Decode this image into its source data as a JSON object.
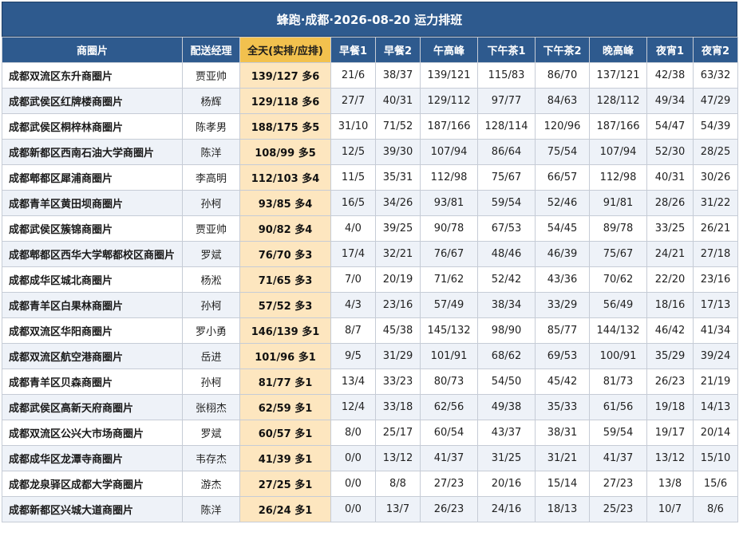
{
  "title": "蜂跑·成都·2026-08-20 运力排班",
  "headers": [
    "商圈片",
    "配送经理",
    "全天(实排/应排)",
    "早餐1",
    "早餐2",
    "午高峰",
    "下午茶1",
    "下午茶2",
    "晚高峰",
    "夜宵1",
    "夜宵2"
  ],
  "rows": [
    {
      "area": "成都双流区东升商圈片",
      "manager": "贾亚帅",
      "total": "139/127 多6",
      "slots": [
        "21/6",
        "38/37",
        "139/121",
        "115/83",
        "86/70",
        "137/121",
        "42/38",
        "63/32"
      ]
    },
    {
      "area": "成都武侯区红牌楼商圈片",
      "manager": "杨辉",
      "total": "129/118 多6",
      "slots": [
        "27/7",
        "40/31",
        "129/112",
        "97/77",
        "84/63",
        "128/112",
        "49/34",
        "47/29"
      ]
    },
    {
      "area": "成都武侯区桐梓林商圈片",
      "manager": "陈孝男",
      "total": "188/175 多5",
      "slots": [
        "31/10",
        "71/52",
        "187/166",
        "128/114",
        "120/96",
        "187/166",
        "54/47",
        "54/39"
      ]
    },
    {
      "area": "成都新都区西南石油大学商圈片",
      "manager": "陈洋",
      "total": "108/99 多5",
      "slots": [
        "12/5",
        "39/30",
        "107/94",
        "86/64",
        "75/54",
        "107/94",
        "52/30",
        "28/25"
      ]
    },
    {
      "area": "成都郫都区犀浦商圈片",
      "manager": "李高明",
      "total": "112/103 多4",
      "slots": [
        "11/5",
        "35/31",
        "112/98",
        "75/67",
        "66/57",
        "112/98",
        "40/31",
        "30/26"
      ]
    },
    {
      "area": "成都青羊区黄田坝商圈片",
      "manager": "孙柯",
      "total": "93/85 多4",
      "slots": [
        "16/5",
        "34/26",
        "93/81",
        "59/54",
        "52/46",
        "91/81",
        "28/26",
        "31/22"
      ]
    },
    {
      "area": "成都武侯区簇锦商圈片",
      "manager": "贾亚帅",
      "total": "90/82 多4",
      "slots": [
        "4/0",
        "39/25",
        "90/78",
        "67/53",
        "54/45",
        "89/78",
        "33/25",
        "26/21"
      ]
    },
    {
      "area": "成都郫都区西华大学郫都校区商圈片",
      "manager": "罗斌",
      "total": "76/70 多3",
      "slots": [
        "17/4",
        "32/21",
        "76/67",
        "48/46",
        "46/39",
        "75/67",
        "24/21",
        "27/18"
      ]
    },
    {
      "area": "成都成华区城北商圈片",
      "manager": "杨淞",
      "total": "71/65 多3",
      "slots": [
        "7/0",
        "20/19",
        "71/62",
        "52/42",
        "43/36",
        "70/62",
        "22/20",
        "23/16"
      ]
    },
    {
      "area": "成都青羊区白果林商圈片",
      "manager": "孙柯",
      "total": "57/52 多3",
      "slots": [
        "4/3",
        "23/16",
        "57/49",
        "38/34",
        "33/29",
        "56/49",
        "18/16",
        "17/13"
      ]
    },
    {
      "area": "成都双流区华阳商圈片",
      "manager": "罗小勇",
      "total": "146/139 多1",
      "slots": [
        "8/7",
        "45/38",
        "145/132",
        "98/90",
        "85/77",
        "144/132",
        "46/42",
        "41/34"
      ]
    },
    {
      "area": "成都双流区航空港商圈片",
      "manager": "岳进",
      "total": "101/96 多1",
      "slots": [
        "9/5",
        "31/29",
        "101/91",
        "68/62",
        "69/53",
        "100/91",
        "35/29",
        "39/24"
      ]
    },
    {
      "area": "成都青羊区贝森商圈片",
      "manager": "孙柯",
      "total": "81/77 多1",
      "slots": [
        "13/4",
        "33/23",
        "80/73",
        "54/50",
        "45/42",
        "81/73",
        "26/23",
        "21/19"
      ]
    },
    {
      "area": "成都武侯区高新天府商圈片",
      "manager": "张栩杰",
      "total": "62/59 多1",
      "slots": [
        "12/4",
        "33/18",
        "62/56",
        "49/38",
        "35/33",
        "61/56",
        "19/18",
        "14/13"
      ]
    },
    {
      "area": "成都双流区公兴大市场商圈片",
      "manager": "罗斌",
      "total": "60/57 多1",
      "slots": [
        "8/0",
        "25/17",
        "60/54",
        "43/37",
        "38/31",
        "59/54",
        "19/17",
        "20/14"
      ]
    },
    {
      "area": "成都成华区龙潭寺商圈片",
      "manager": "韦存杰",
      "total": "41/39 多1",
      "slots": [
        "0/0",
        "13/12",
        "41/37",
        "31/25",
        "31/21",
        "41/37",
        "13/12",
        "15/10"
      ]
    },
    {
      "area": "成都龙泉驿区成都大学商圈片",
      "manager": "游杰",
      "total": "27/25 多1",
      "slots": [
        "0/0",
        "8/8",
        "27/23",
        "20/16",
        "15/14",
        "27/23",
        "13/8",
        "15/6"
      ]
    },
    {
      "area": "成都新都区兴城大道商圈片",
      "manager": "陈洋",
      "total": "26/24 多1",
      "slots": [
        "0/0",
        "13/7",
        "26/23",
        "24/16",
        "18/13",
        "25/23",
        "10/7",
        "8/6"
      ]
    }
  ]
}
